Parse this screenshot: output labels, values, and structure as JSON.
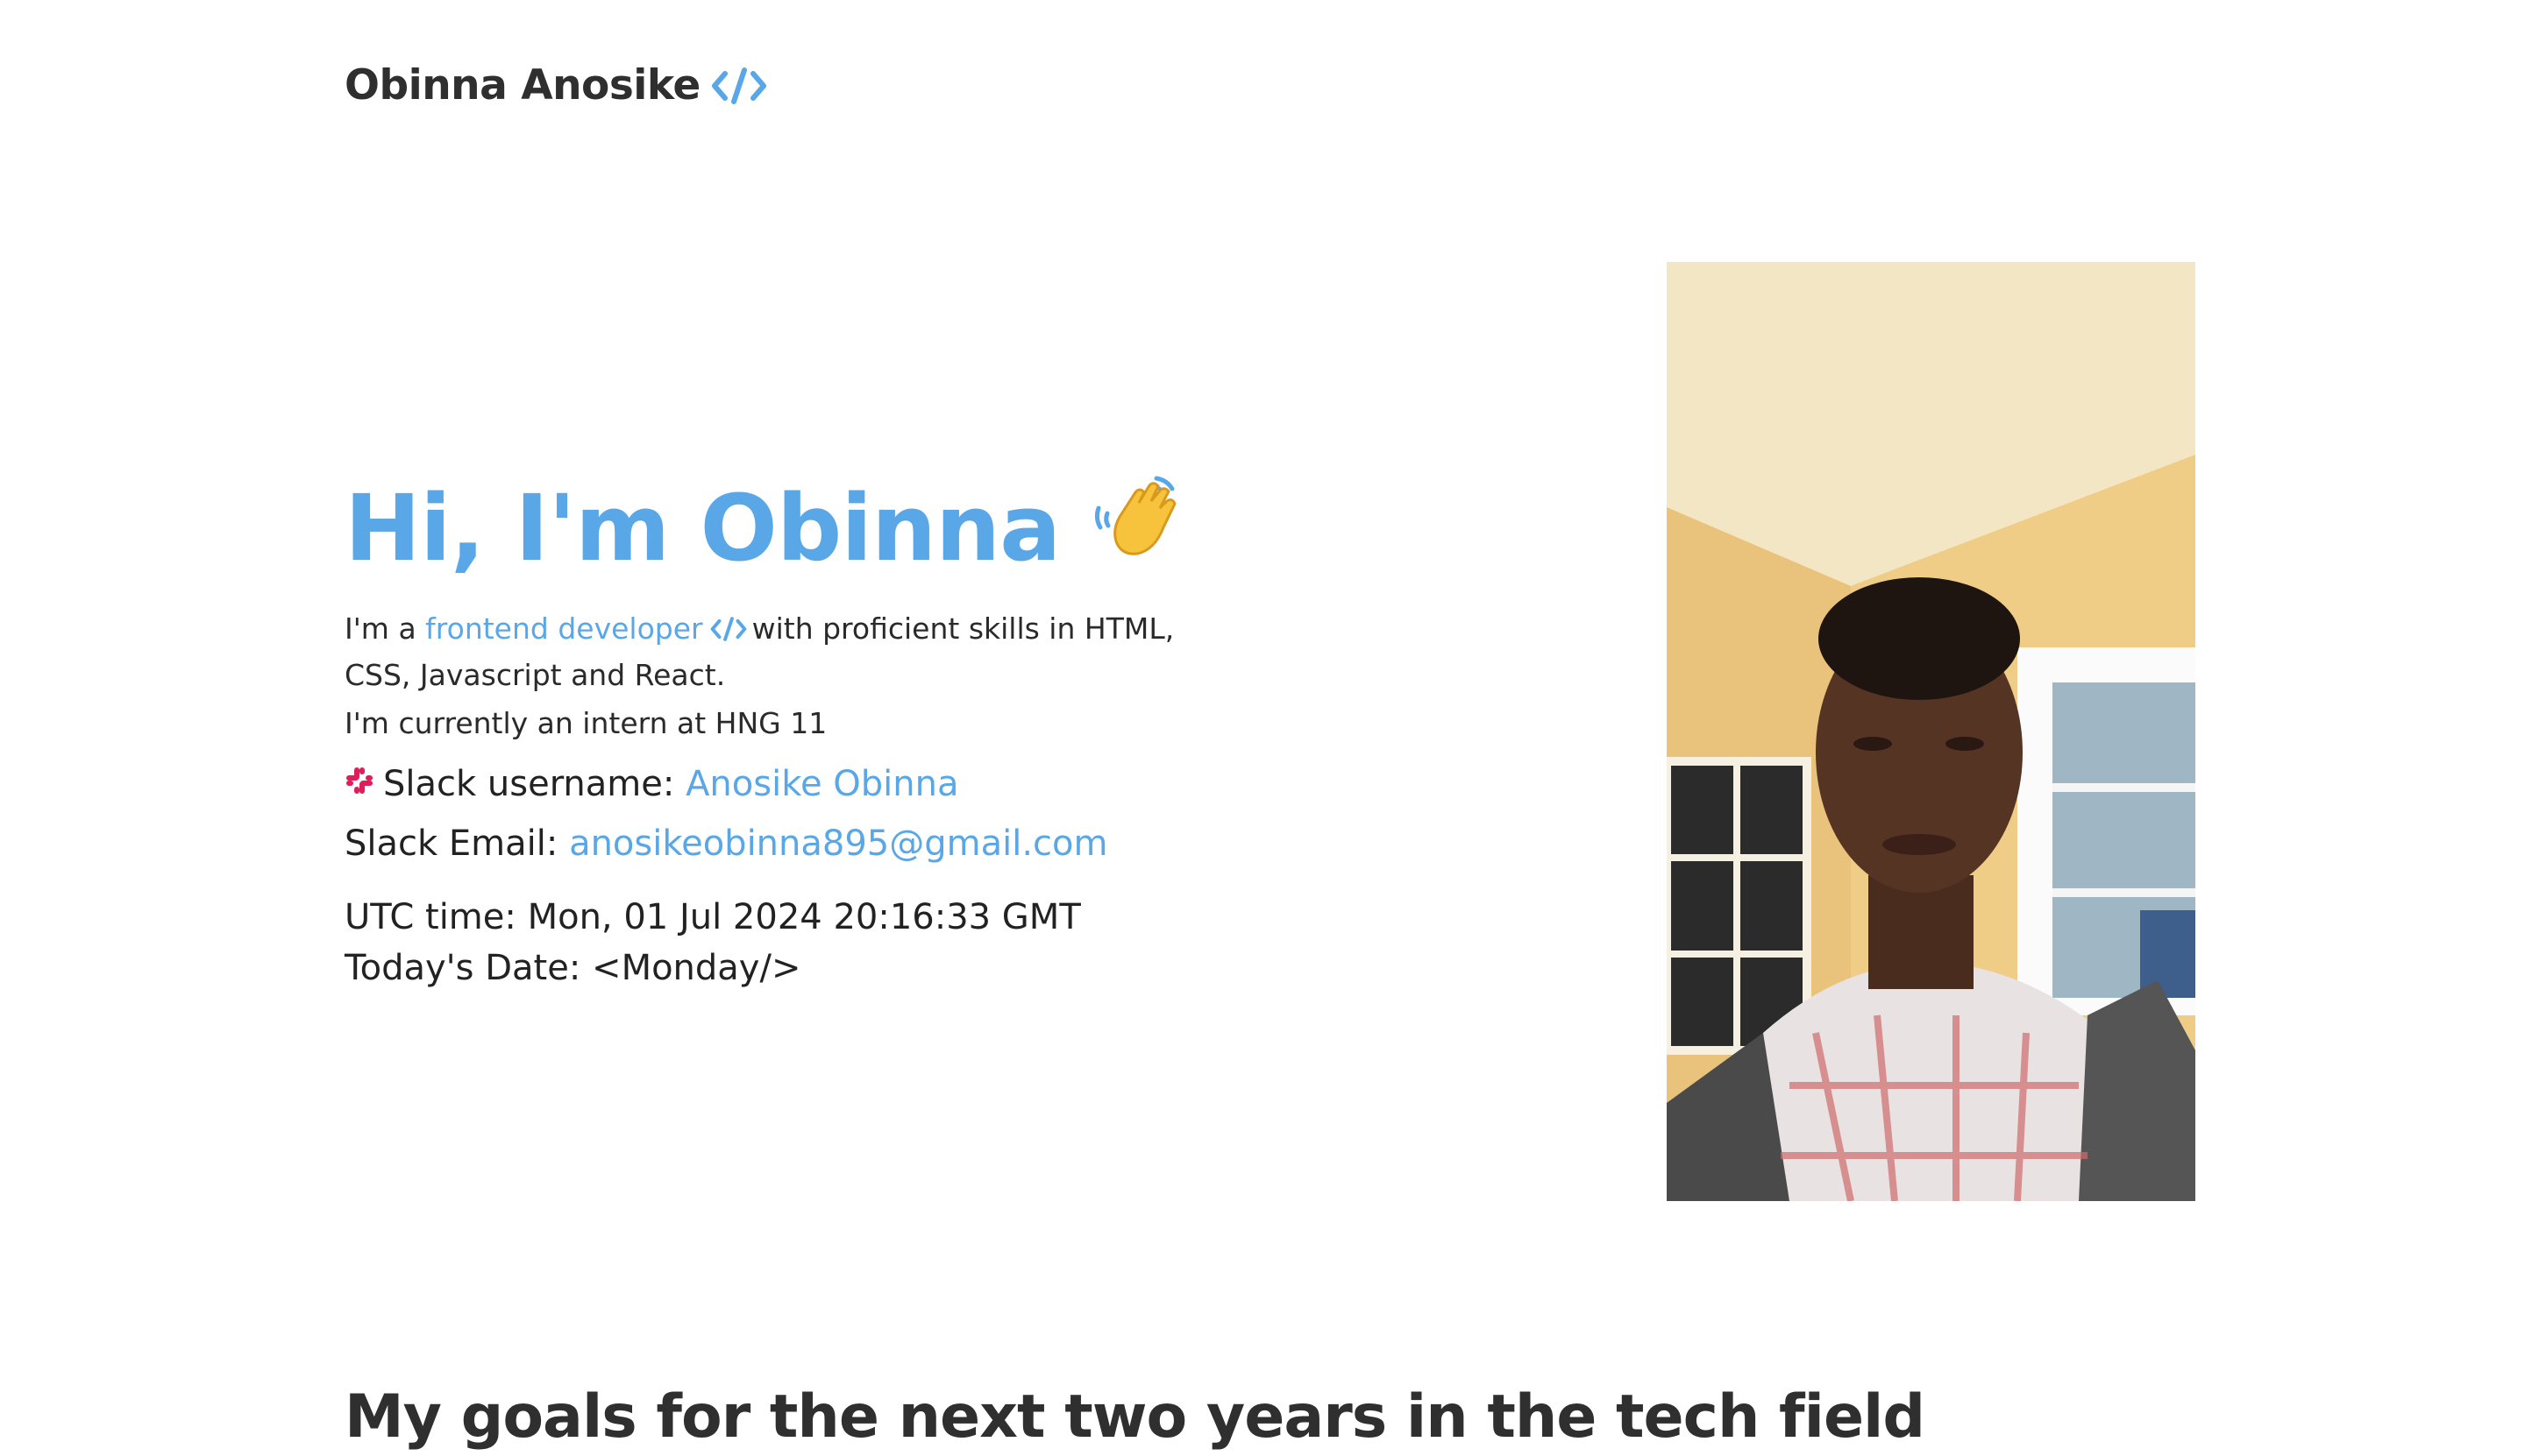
{
  "header": {
    "brand_name": "Obinna Anosike",
    "brand_icon": "code-brackets-icon"
  },
  "hero": {
    "title": "Hi, I'm Obinna",
    "title_icon": "waving-hand-icon",
    "intro_prefix": "I'm a",
    "intro_link": "frontend developer",
    "intro_link_icon": "code-brackets-icon",
    "intro_suffix": "with proficient skills in HTML, CSS, Javascript and React.",
    "intern_text": "I'm currently an intern at HNG 11",
    "slack_username_label": "Slack username:",
    "slack_username_value": "Anosike Obinna",
    "slack_username_icon": "slack-icon",
    "slack_email_label": "Slack Email:",
    "slack_email_value": "anosikeobinna895@gmail.com",
    "utc_label": "UTC time:",
    "utc_value": "Mon, 01 Jul 2024 20:16:33 GMT",
    "today_label": "Today's Date:",
    "today_value": "<Monday/>"
  },
  "profile_photo": {
    "subject": "profile-photo"
  },
  "goals": {
    "title": "My goals for the next two years in the tech field"
  },
  "colors": {
    "accent": "#5aa7e8",
    "text": "#222222",
    "heading": "#2f2f2f"
  }
}
